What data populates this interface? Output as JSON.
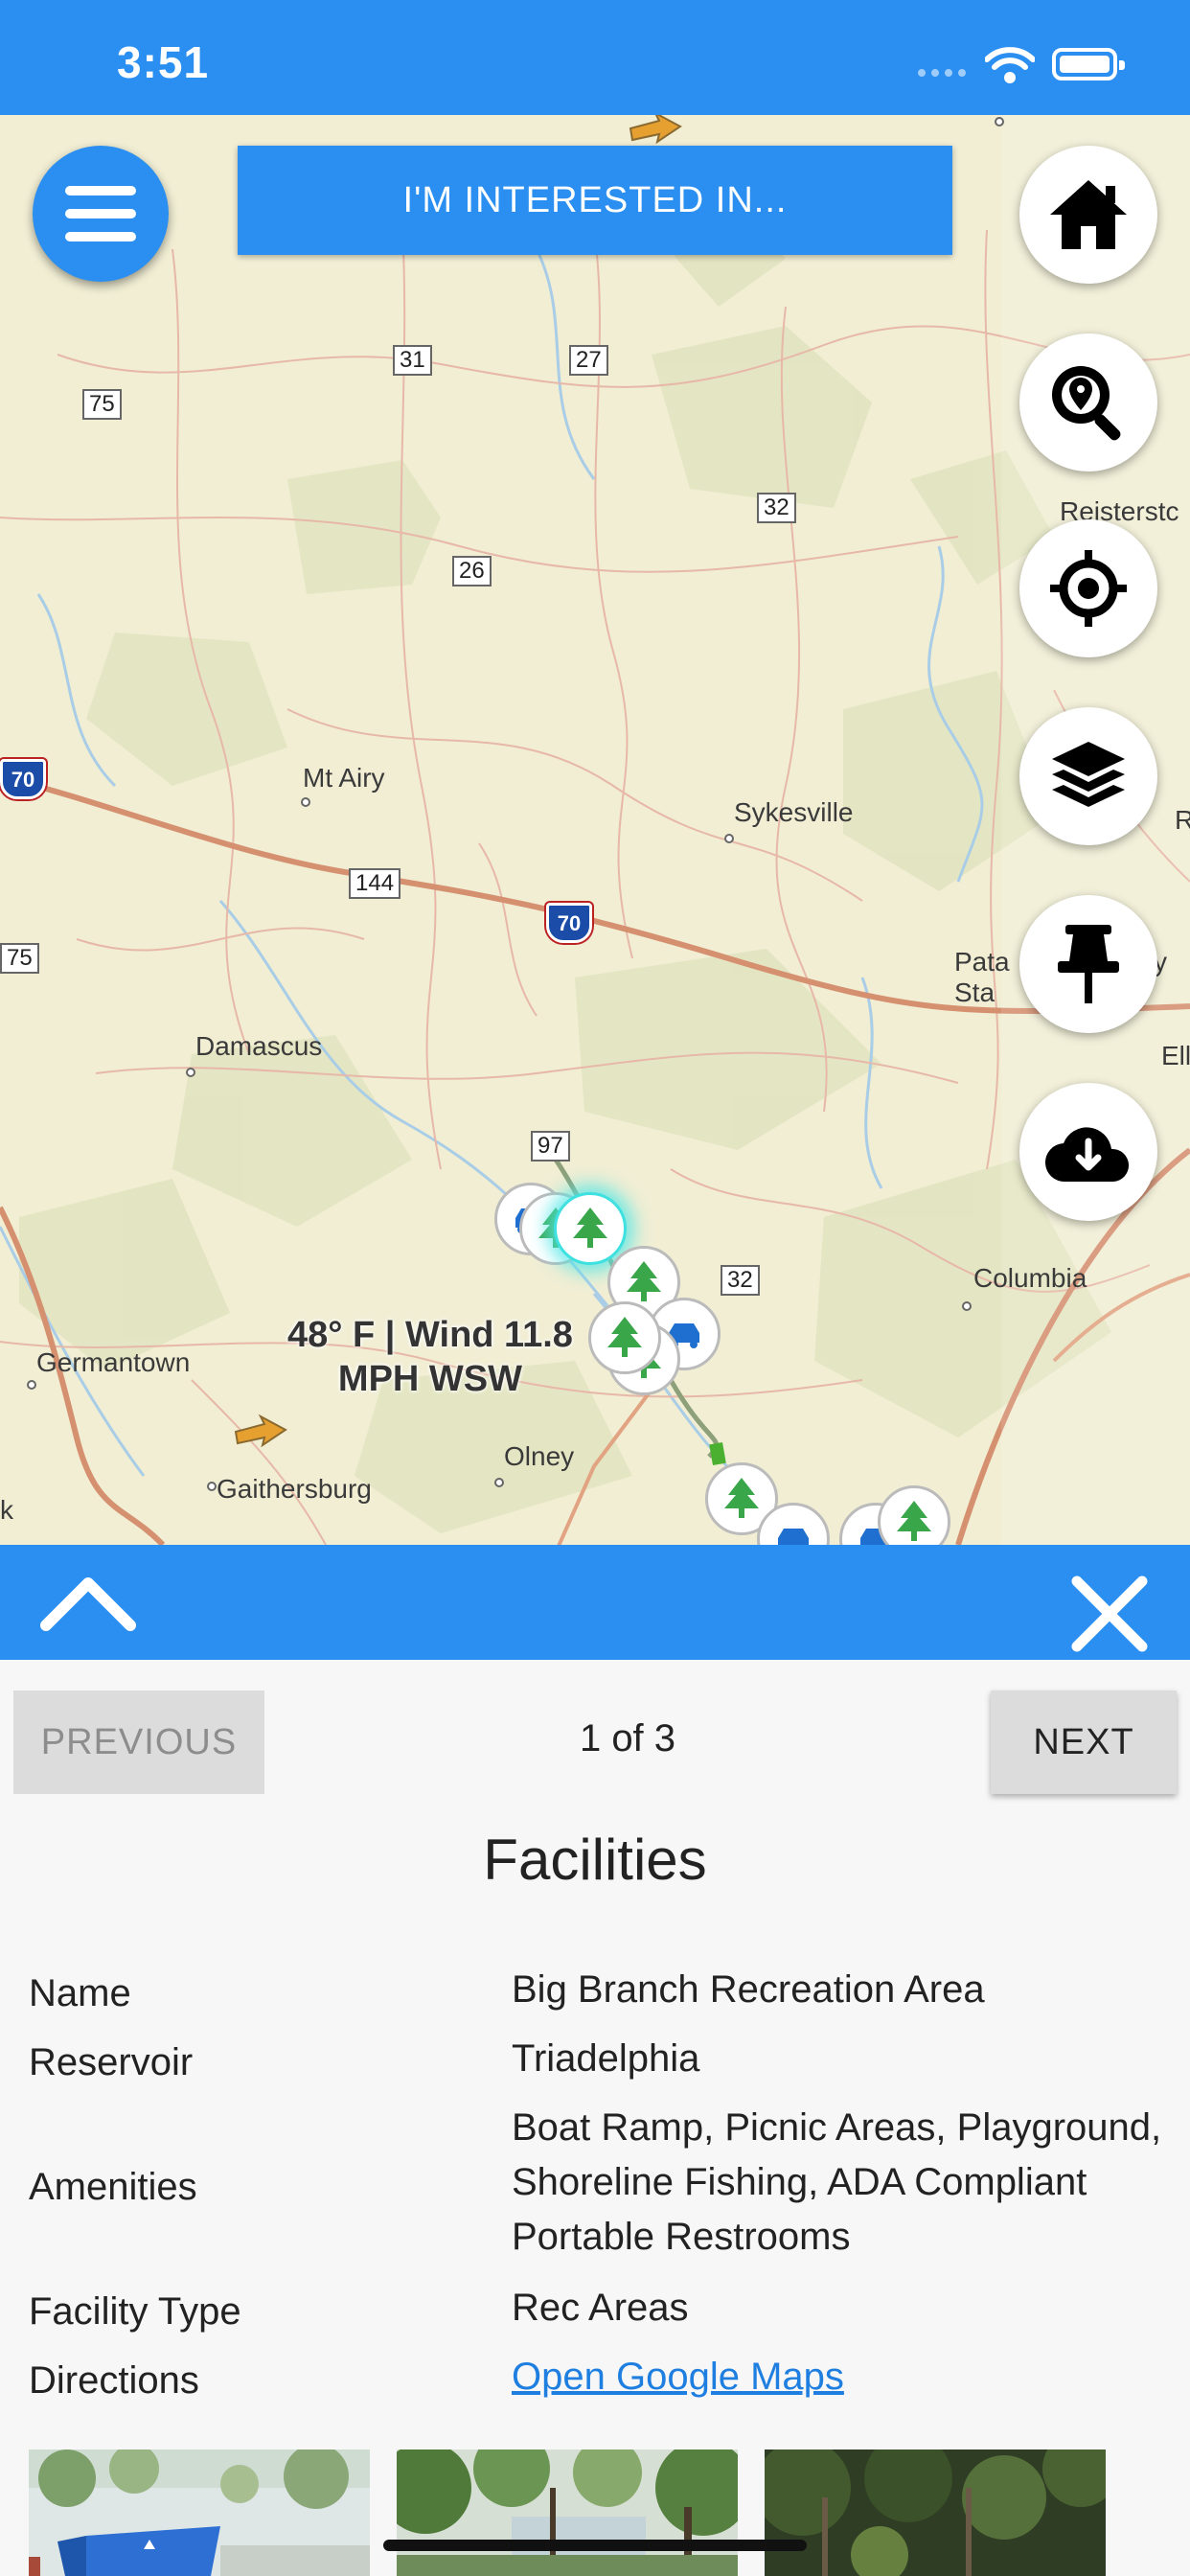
{
  "status": {
    "time": "3:51"
  },
  "map": {
    "labels": {
      "mt_airy": "Mt Airy",
      "sykesville": "Sykesville",
      "damascus": "Damascus",
      "germantown": "Germantown",
      "gaithersburg": "Gaithersburg",
      "olney": "Olney",
      "columbia": "Columbia",
      "reisterstown": "Reisterstc",
      "patapsco": "Pata\nSta",
      "edge_r": "R",
      "edge_y": "y",
      "ellic": "Ellic",
      "edge_k": "k"
    },
    "routes": {
      "r31": "31",
      "r27": "27",
      "r75": "75",
      "r32a": "32",
      "r26": "26",
      "r144": "144",
      "r97": "97",
      "r32b": "32",
      "r75b": "75",
      "i70a": "70",
      "i70b": "70"
    },
    "weather": {
      "line1": "48° F | Wind 11.8",
      "line2": "MPH  WSW"
    }
  },
  "toolbar": {
    "interest_label": "I'M INTERESTED IN...",
    "icons": [
      "menu-icon",
      "home-icon",
      "search-location-icon",
      "locate-icon",
      "layers-icon",
      "pushpin-icon",
      "cloud-download-icon"
    ]
  },
  "panel": {
    "previous_label": "PREVIOUS",
    "next_label": "NEXT",
    "pager": "1 of 3",
    "title": "Facilities",
    "fields": {
      "name_label": "Name",
      "name_value": "Big Branch Recreation Area",
      "reservoir_label": "Reservoir",
      "reservoir_value": "Triadelphia",
      "amenities_label": "Amenities",
      "amenities_value": "Boat Ramp, Picnic Areas, Playground, Shoreline Fishing, ADA Compliant Portable Restrooms",
      "type_label": "Facility Type",
      "type_value": "Rec Areas",
      "directions_label": "Directions",
      "directions_value": "Open Google Maps"
    }
  },
  "colors": {
    "accent": "#2a8ff0",
    "link": "#1f7fe0",
    "map_bg": "#f1eed4",
    "tree": "#3aa64a"
  }
}
